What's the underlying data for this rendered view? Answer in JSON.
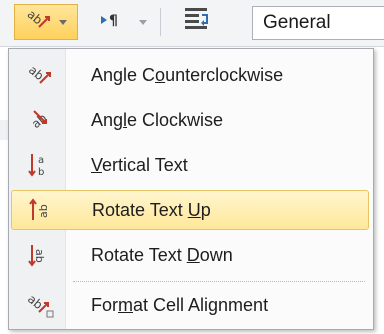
{
  "ribbon": {
    "orientation_icon": "orientation-ab-icon",
    "text_direction_icon": "text-direction-pilcrow-icon",
    "wrap_icon": "wrap-text-icon",
    "number_format_value": "General"
  },
  "menu": {
    "items": [
      {
        "icon": "angle-counterclockwise-icon",
        "pre": "Angle C",
        "key": "o",
        "post": "unterclockwise"
      },
      {
        "icon": "angle-clockwise-icon",
        "pre": "Ang",
        "key": "l",
        "post": "e Clockwise"
      },
      {
        "icon": "vertical-text-icon",
        "pre": "",
        "key": "V",
        "post": "ertical Text"
      },
      {
        "icon": "rotate-text-up-icon",
        "pre": "Rotate Text ",
        "key": "U",
        "post": "p"
      },
      {
        "icon": "rotate-text-down-icon",
        "pre": "Rotate Text ",
        "key": "D",
        "post": "own"
      },
      {
        "icon": "format-cell-alignment-icon",
        "pre": "For",
        "key": "m",
        "post": "at Cell Alignment"
      }
    ],
    "highlighted_index": 3
  },
  "colors": {
    "highlight": "#ffe79a",
    "accent_red": "#c0392b",
    "icon_gray": "#555555"
  }
}
